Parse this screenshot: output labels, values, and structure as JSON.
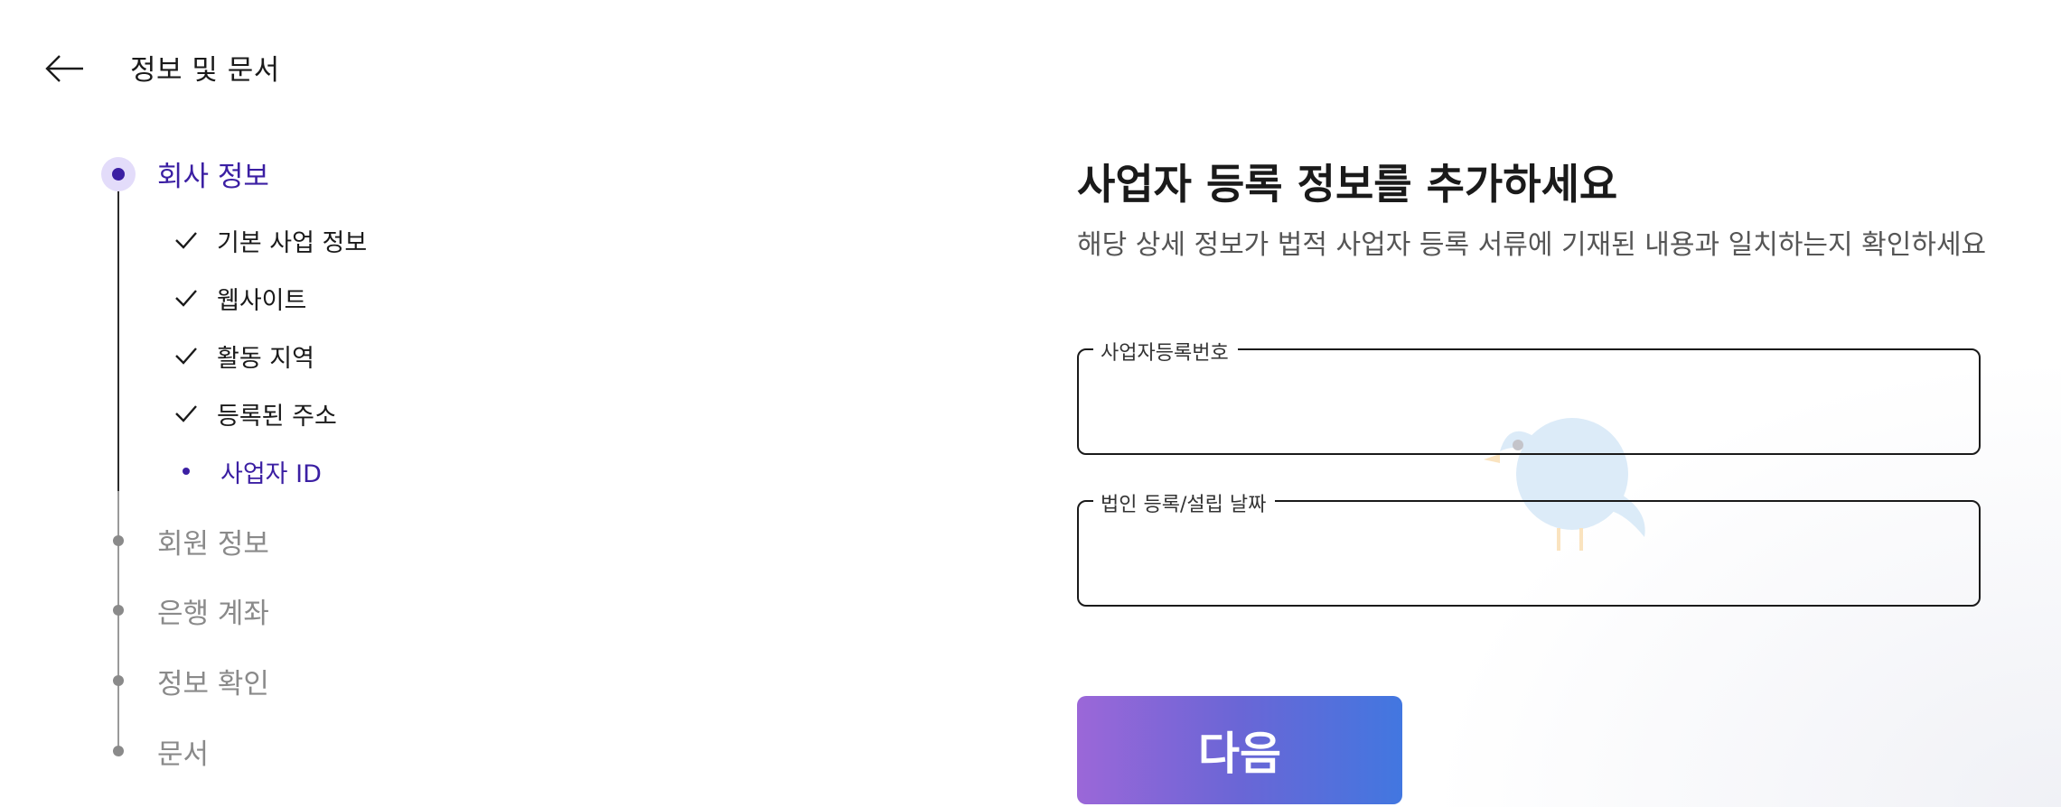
{
  "header": {
    "title": "정보 및 문서",
    "back_icon": "arrow-left-icon"
  },
  "stepper": {
    "active_step": {
      "label": "회사 정보"
    },
    "substeps": [
      {
        "label": "기본 사업 정보",
        "status": "done"
      },
      {
        "label": "웹사이트",
        "status": "done"
      },
      {
        "label": "활동 지역",
        "status": "done"
      },
      {
        "label": "등록된 주소",
        "status": "done"
      },
      {
        "label": "사업자 ID",
        "status": "current"
      }
    ],
    "upcoming_steps": [
      {
        "label": "회원 정보"
      },
      {
        "label": "은행 계좌"
      },
      {
        "label": "정보 확인"
      },
      {
        "label": "문서"
      }
    ]
  },
  "main": {
    "title": "사업자 등록 정보를 추가하세요",
    "subtitle": "해당 상세 정보가 법적 사업자 등록 서류에 기재된 내용과 일치하는지 확인하세요",
    "fields": [
      {
        "label": "사업자등록번호",
        "value": ""
      },
      {
        "label": "법인 등록/설립 날짜",
        "value": ""
      }
    ],
    "next_button": "다음"
  },
  "colors": {
    "accent": "#3b1fa3",
    "active_step_halo": "#e3dcfa",
    "muted": "#8a8a8a",
    "button_gradient_start": "#9b67d8",
    "button_gradient_end": "#4277e0"
  }
}
